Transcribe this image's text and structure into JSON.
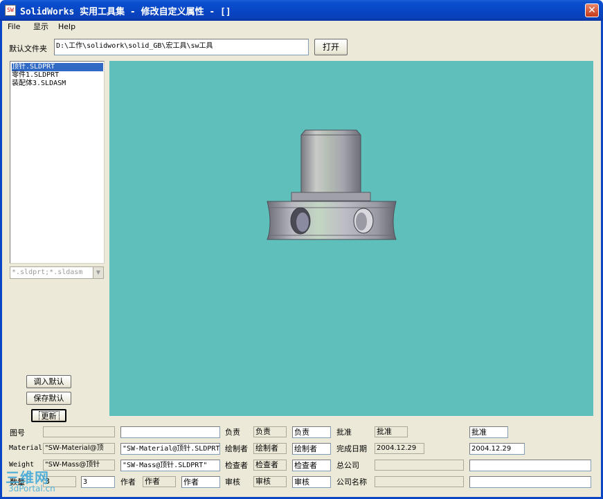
{
  "window": {
    "title": "SolidWorks 实用工具集 - 修改自定义属性 - []",
    "close_glyph": "✕"
  },
  "menu": [
    {
      "label": "File"
    },
    {
      "label": "显示"
    },
    {
      "label": "Help"
    }
  ],
  "folder": {
    "label": "默认文件夹",
    "path": "D:\\工作\\solidwork\\solid_GB\\宏工具\\sw工具",
    "open_button": "打开"
  },
  "file_list": {
    "items": [
      "顶针.SLDPRT",
      "零件1.SLDPRT",
      "装配体3.SLDASM"
    ],
    "selected_index": 0,
    "filter": "*.sldprt;*.sldasm"
  },
  "buttons": {
    "load_default": "调入默认",
    "save_default": "保存默认",
    "update": "更新"
  },
  "properties": {
    "col1": [
      {
        "label": "图号",
        "field": "",
        "value": ""
      },
      {
        "label": "Material",
        "field": "\"SW-Material@顶",
        "value": "\"SW-Material@顶针.SLDPRT\""
      },
      {
        "label": "Weight",
        "field": "\"SW-Mass@顶针",
        "value": "\"SW-Mass@顶针.SLDPRT\""
      },
      {
        "label": "数量",
        "field": "3",
        "value": "3"
      }
    ],
    "col2": [
      {
        "label": "负责",
        "field": "负责",
        "value": "负责"
      },
      {
        "label": "绘制者",
        "field": "绘制者",
        "value": "绘制者"
      },
      {
        "label": "检查者",
        "field": "检查者",
        "value": "检查者"
      },
      {
        "label": "审核",
        "field": "审核",
        "value": "审核"
      }
    ],
    "author": {
      "label": "作者",
      "field": "作者",
      "value": "作者"
    },
    "col3": [
      {
        "label": "批准",
        "field": "批准",
        "value": "批准"
      },
      {
        "label": "完成日期",
        "field": "2004.12.29",
        "value": "2004.12.29"
      },
      {
        "label": "总公司",
        "field": "",
        "value": ""
      },
      {
        "label": "公司名称",
        "field": "",
        "value": ""
      }
    ]
  },
  "watermark": {
    "main": "三维网",
    "sub": "3dPortal.cn"
  },
  "colors": {
    "viewport_bg": "#5fbfbb",
    "window_bg": "#ece9d8",
    "title_bar": "#0846c4",
    "selection": "#316ac5"
  }
}
